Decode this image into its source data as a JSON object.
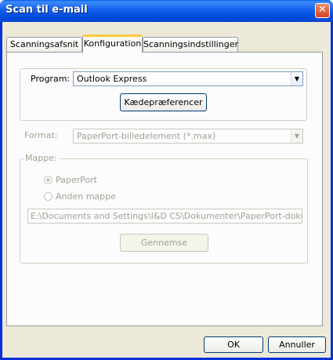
{
  "window": {
    "title": "Scan til e-mail"
  },
  "tabs": [
    "Scanningsafsnit",
    "Konfiguration",
    "Scanningsindstillinger"
  ],
  "program": {
    "label": "Program:",
    "value": "Outlook Express",
    "prefs_button": "Kædepræferencer"
  },
  "format": {
    "label": "Format:",
    "value": "PaperPort-billedelement (*.max)"
  },
  "folder": {
    "label": "Mappe:",
    "options": [
      "PaperPort",
      "Anden mappe"
    ],
    "selected": "PaperPort",
    "path": "E:\\Documents and Settings\\I&D CS\\Dokumenter\\PaperPort-dokument",
    "browse_button": "Gennemse"
  },
  "footer": {
    "ok": "OK",
    "cancel": "Annuller"
  },
  "colors": {
    "titlebar": "#0054e3",
    "face": "#ece9d8",
    "tab_highlight": "#ffc83c"
  }
}
